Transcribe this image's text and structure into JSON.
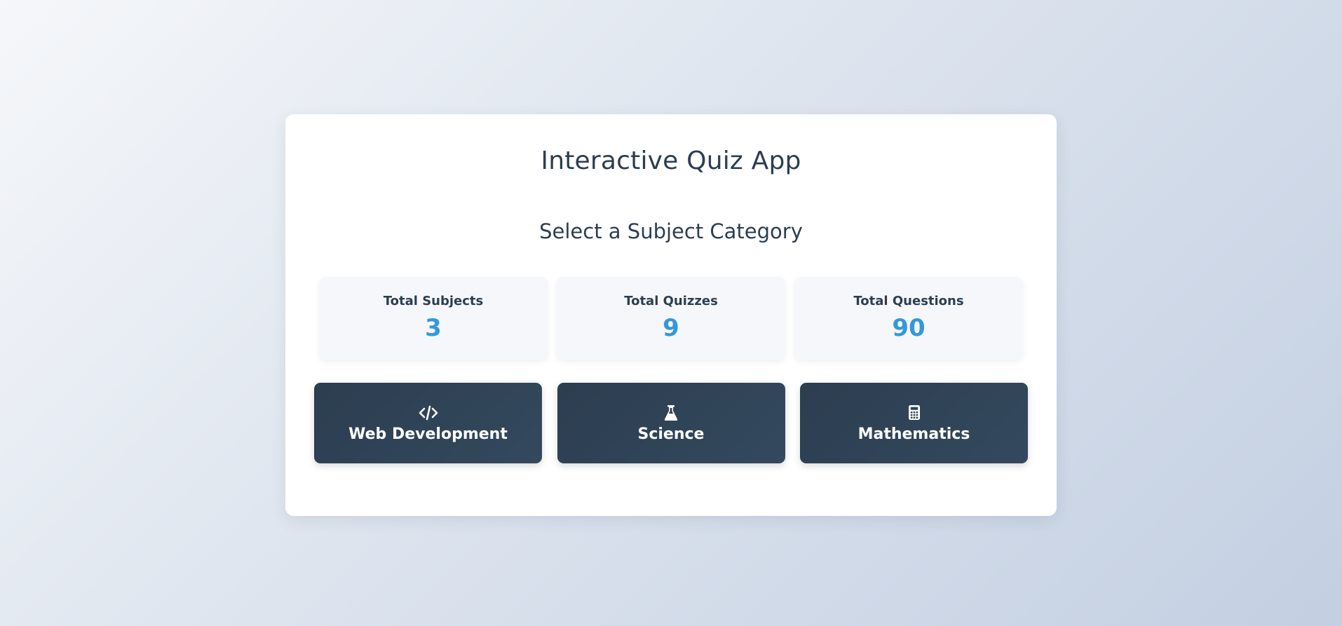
{
  "app": {
    "title": "Interactive Quiz App"
  },
  "selection": {
    "heading": "Select a Subject Category"
  },
  "stats": [
    {
      "label": "Total Subjects",
      "value": "3"
    },
    {
      "label": "Total Quizzes",
      "value": "9"
    },
    {
      "label": "Total Questions",
      "value": "90"
    }
  ],
  "subjects": [
    {
      "label": "Web Development",
      "icon": "code-icon"
    },
    {
      "label": "Science",
      "icon": "flask-icon"
    },
    {
      "label": "Mathematics",
      "icon": "calculator-icon"
    }
  ],
  "colors": {
    "primary": "#2c3e50",
    "primary_light": "#34495e",
    "accent": "#3498db",
    "card_bg": "#ffffff",
    "stat_bg": "#f5f7fa"
  }
}
